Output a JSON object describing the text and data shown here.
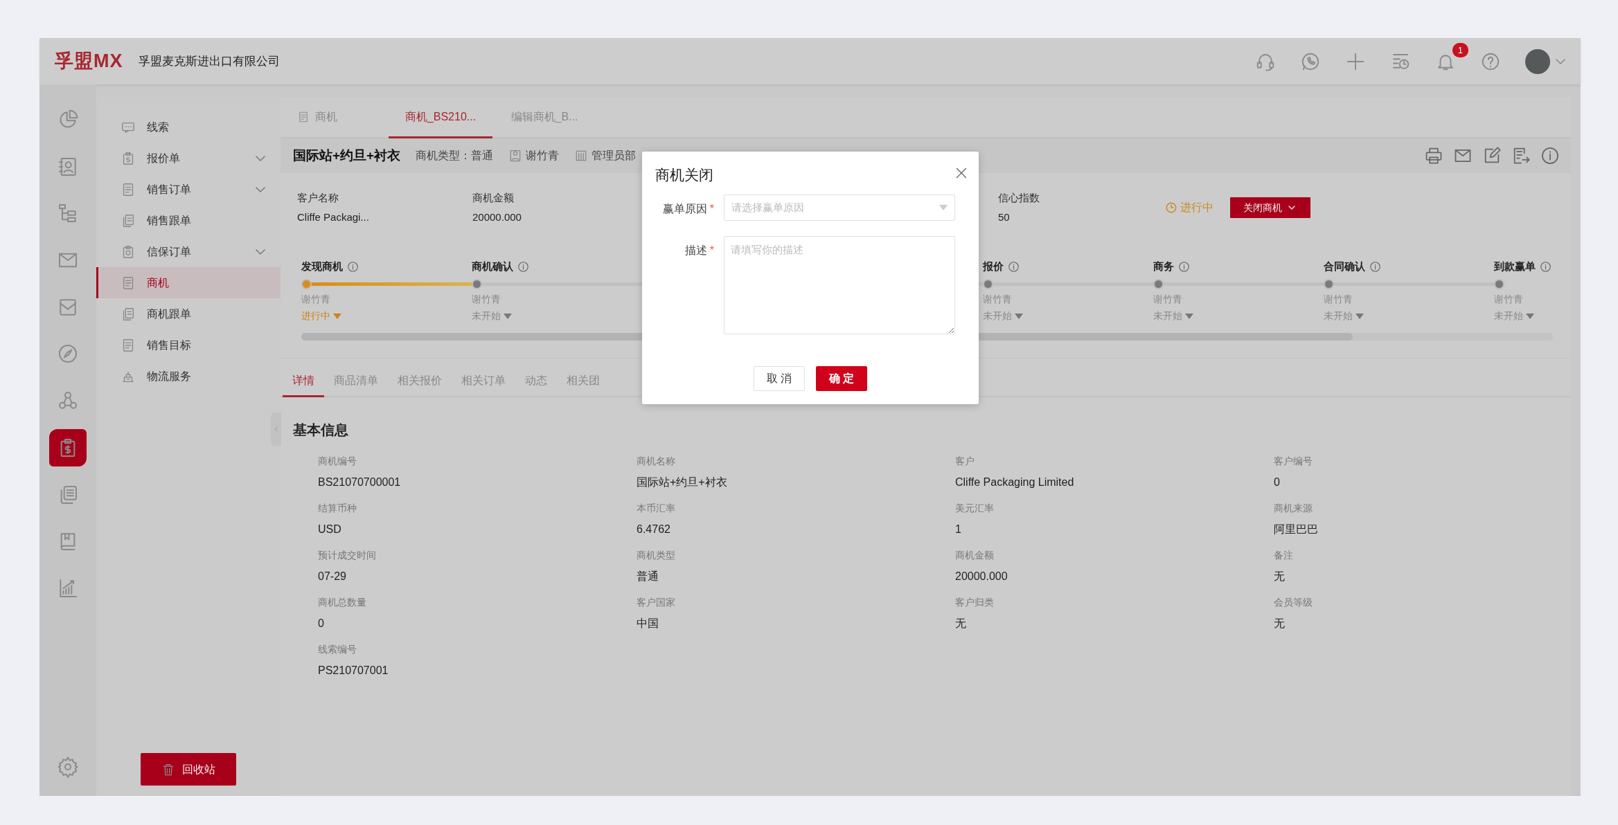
{
  "header": {
    "logo": "孚盟MX",
    "company": "孚盟麦克斯进出口有限公司",
    "notification_count": "1"
  },
  "rail": [
    {
      "selected": false
    },
    {
      "selected": false
    },
    {
      "selected": false
    },
    {
      "selected": false
    },
    {
      "selected": false
    },
    {
      "selected": false
    },
    {
      "selected": false
    },
    {
      "selected": true
    },
    {
      "selected": false
    },
    {
      "selected": false
    },
    {
      "selected": false
    }
  ],
  "menu": [
    {
      "label": "线索",
      "expandable": false,
      "selected": false
    },
    {
      "label": "报价单",
      "expandable": true,
      "selected": false
    },
    {
      "label": "销售订单",
      "expandable": true,
      "selected": false
    },
    {
      "label": "销售跟单",
      "expandable": false,
      "selected": false
    },
    {
      "label": "信保订单",
      "expandable": true,
      "selected": false
    },
    {
      "label": "商机",
      "expandable": false,
      "selected": true
    },
    {
      "label": "商机跟单",
      "expandable": false,
      "selected": false
    },
    {
      "label": "销售目标",
      "expandable": false,
      "selected": false
    },
    {
      "label": "物流服务",
      "expandable": false,
      "selected": false
    }
  ],
  "recycle_button": "回收站",
  "page_tabs": [
    {
      "label": "商机",
      "kind": "list",
      "selected": false
    },
    {
      "label": "商机_BS210...",
      "kind": "plain",
      "selected": true
    },
    {
      "label": "编辑商机_B...",
      "kind": "plain",
      "selected": false
    }
  ],
  "title": {
    "name": "国际站+约旦+衬衣",
    "type": "商机类型：普通",
    "owner": "谢竹青",
    "department": "管理员部"
  },
  "summary": [
    {
      "kind": "field",
      "label": "客户名称",
      "value": "Cliffe Packagi..."
    },
    {
      "kind": "field",
      "label": "商机金额",
      "value": "20000.000"
    },
    {
      "kind": "covered"
    },
    {
      "kind": "covered"
    },
    {
      "kind": "field",
      "label": "信心指数",
      "value": "50"
    }
  ],
  "status": "进行中",
  "close_button": "关闭商机",
  "stages": [
    {
      "kind": "stage",
      "label": "发现商机",
      "owner": "谢竹青",
      "status": "进行中",
      "active": true
    },
    {
      "kind": "stage",
      "label": "商机确认",
      "owner": "谢竹青",
      "status": "未开始",
      "active": false
    },
    {
      "kind": "covered"
    },
    {
      "kind": "covered"
    },
    {
      "kind": "stage",
      "label": "报价",
      "owner": "谢竹青",
      "status": "未开始",
      "active": false
    },
    {
      "kind": "stage",
      "label": "商务",
      "owner": "谢竹青",
      "status": "未开始",
      "active": false
    },
    {
      "kind": "stage",
      "label": "合同确认",
      "owner": "谢竹青",
      "status": "未开始",
      "active": false
    },
    {
      "kind": "stage",
      "label": "到款赢单",
      "owner": "谢竹青",
      "status": "未开始",
      "active": false
    }
  ],
  "detail_tabs": [
    {
      "label": "详情",
      "selected": true
    },
    {
      "label": "商品清单",
      "selected": false
    },
    {
      "label": "相关报价",
      "selected": false
    },
    {
      "label": "相关订单",
      "selected": false
    },
    {
      "label": "动态",
      "selected": false
    },
    {
      "label": "相关团",
      "selected": false
    }
  ],
  "section_title": "基本信息",
  "fields": [
    {
      "label": "商机编号",
      "value": "BS21070700001"
    },
    {
      "label": "商机名称",
      "value": "国际站+约旦+衬衣"
    },
    {
      "label": "客户",
      "value": "Cliffe Packaging Limited"
    },
    {
      "label": "客户编号",
      "value": "0"
    },
    {
      "label": "结算币种",
      "value": "USD"
    },
    {
      "label": "本币汇率",
      "value": "6.4762"
    },
    {
      "label": "美元汇率",
      "value": "1"
    },
    {
      "label": "商机来源",
      "value": "阿里巴巴"
    },
    {
      "label": "预计成交时间",
      "value": "07-29"
    },
    {
      "label": "商机类型",
      "value": "普通"
    },
    {
      "label": "商机金额",
      "value": "20000.000"
    },
    {
      "label": "备注",
      "value": "无"
    },
    {
      "label": "商机总数量",
      "value": "0"
    },
    {
      "label": "客户国家",
      "value": "中国"
    },
    {
      "label": "客户归类",
      "value": "无"
    },
    {
      "label": "会员等级",
      "value": "无"
    },
    {
      "label": "线索编号",
      "value": "PS210707001"
    }
  ],
  "dialog": {
    "title": "商机关闭",
    "fields": [
      {
        "kind": "select",
        "label": "赢单原因",
        "required_mark": "*",
        "placeholder": "请选择赢单原因"
      },
      {
        "kind": "textarea",
        "label": "描述",
        "required_mark": "*",
        "placeholder": "请填写你的描述"
      }
    ],
    "buttons": [
      {
        "label": "取 消",
        "kind": "secondary"
      },
      {
        "label": "确 定",
        "kind": "primary"
      }
    ]
  }
}
